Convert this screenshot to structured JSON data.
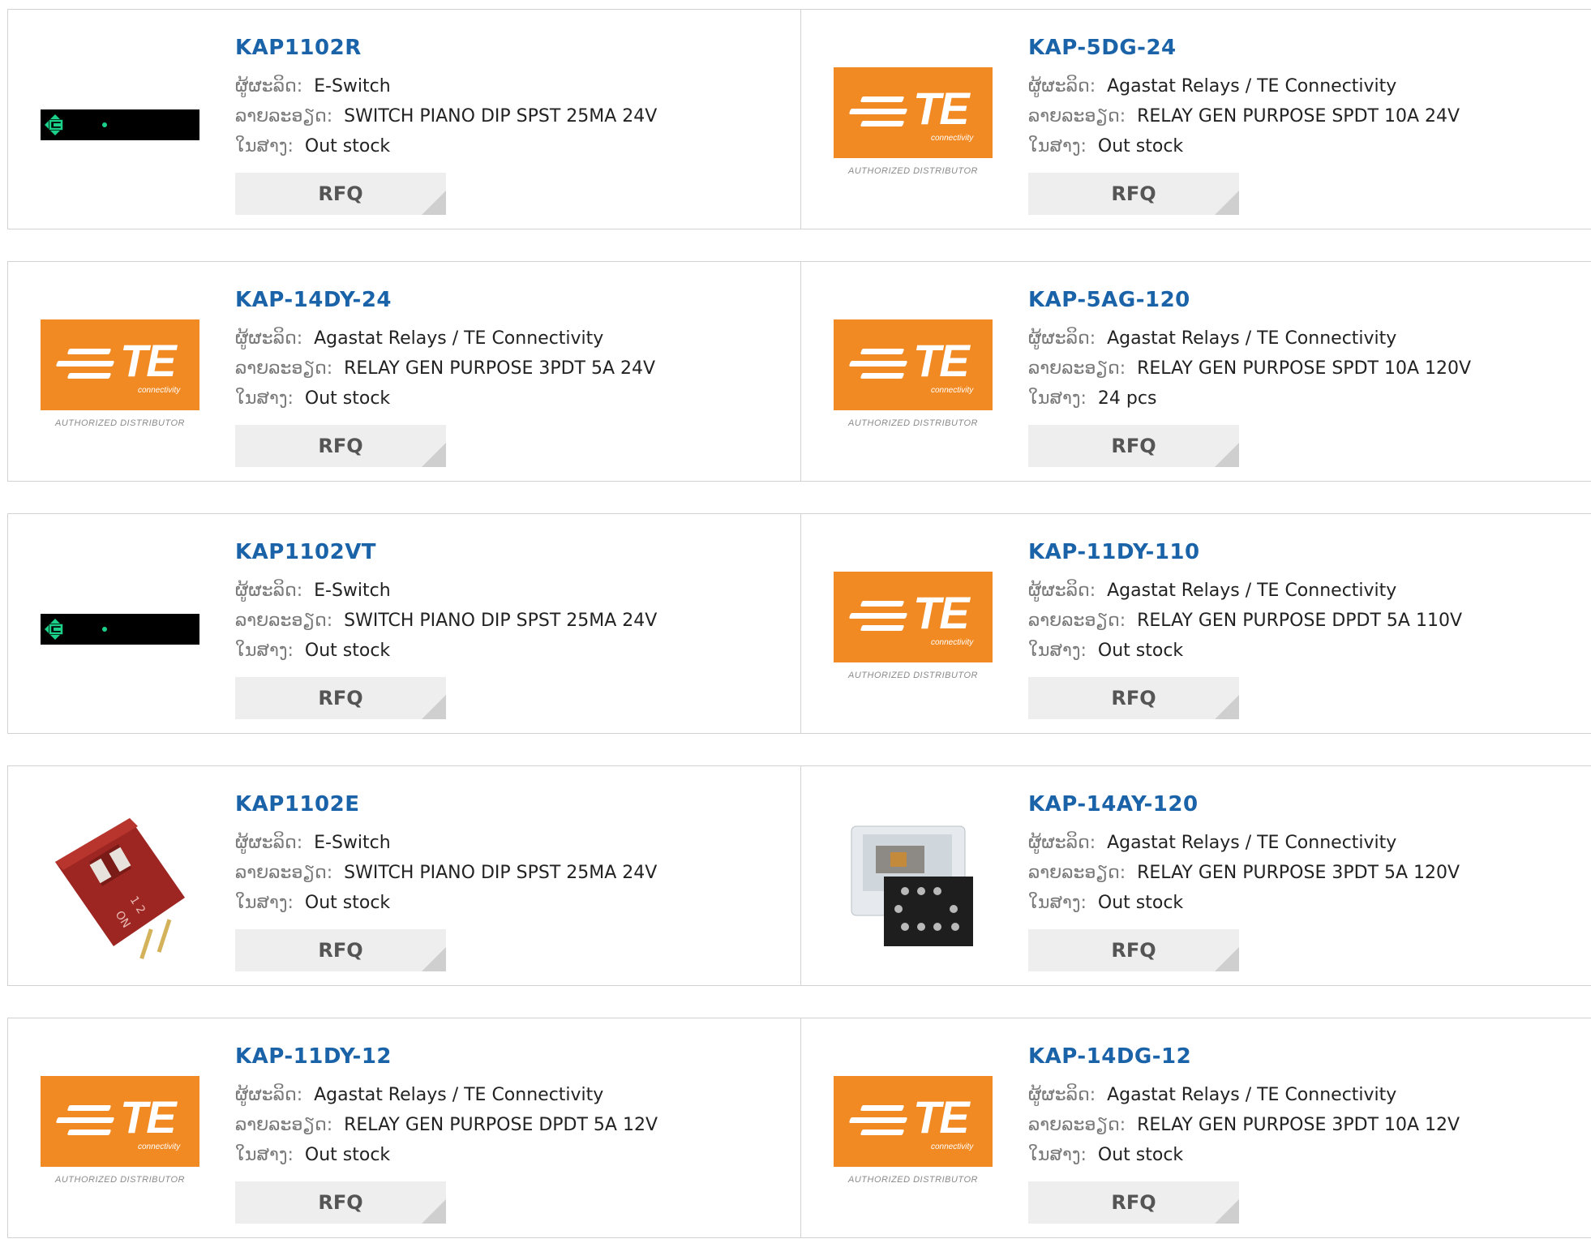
{
  "labels": {
    "manufacturer": "ຜູ້ຜະລິດ:",
    "description": "ລາຍລະອຽດ:",
    "stock": "ໃນສາງ:",
    "rfq": "RFQ"
  },
  "te_logo": {
    "brand": "TE",
    "sub": "connectivity",
    "tagline": "AUTHORIZED DISTRIBUTOR"
  },
  "rows": [
    [
      {
        "part": "KAP1102R",
        "manufacturer": "E-Switch",
        "description": "SWITCH PIANO DIP SPST 25MA 24V",
        "stock": "Out stock",
        "image": "eswitch-logo"
      },
      {
        "part": "KAP-5DG-24",
        "manufacturer": "Agastat Relays / TE Connectivity",
        "description": "RELAY GEN PURPOSE SPDT 10A 24V",
        "stock": "Out stock",
        "image": "te-logo"
      }
    ],
    [
      {
        "part": "KAP-14DY-24",
        "manufacturer": "Agastat Relays / TE Connectivity",
        "description": "RELAY GEN PURPOSE 3PDT 5A 24V",
        "stock": "Out stock",
        "image": "te-logo"
      },
      {
        "part": "KAP-5AG-120",
        "manufacturer": "Agastat Relays / TE Connectivity",
        "description": "RELAY GEN PURPOSE SPDT 10A 120V",
        "stock": "24 pcs",
        "image": "te-logo"
      }
    ],
    [
      {
        "part": "KAP1102VT",
        "manufacturer": "E-Switch",
        "description": "SWITCH PIANO DIP SPST 25MA 24V",
        "stock": "Out stock",
        "image": "eswitch-logo"
      },
      {
        "part": "KAP-11DY-110",
        "manufacturer": "Agastat Relays / TE Connectivity",
        "description": "RELAY GEN PURPOSE DPDT 5A 110V",
        "stock": "Out stock",
        "image": "te-logo"
      }
    ],
    [
      {
        "part": "KAP1102E",
        "manufacturer": "E-Switch",
        "description": "SWITCH PIANO DIP SPST 25MA 24V",
        "stock": "Out stock",
        "image": "red-dip-switch"
      },
      {
        "part": "KAP-14AY-120",
        "manufacturer": "Agastat Relays / TE Connectivity",
        "description": "RELAY GEN PURPOSE 3PDT 5A 120V",
        "stock": "Out stock",
        "image": "relay-photo"
      }
    ],
    [
      {
        "part": "KAP-11DY-12",
        "manufacturer": "Agastat Relays / TE Connectivity",
        "description": "RELAY GEN PURPOSE DPDT 5A 12V",
        "stock": "Out stock",
        "image": "te-logo"
      },
      {
        "part": "KAP-14DG-12",
        "manufacturer": "Agastat Relays / TE Connectivity",
        "description": "RELAY GEN PURPOSE 3PDT 10A 12V",
        "stock": "Out stock",
        "image": "te-logo"
      }
    ]
  ]
}
